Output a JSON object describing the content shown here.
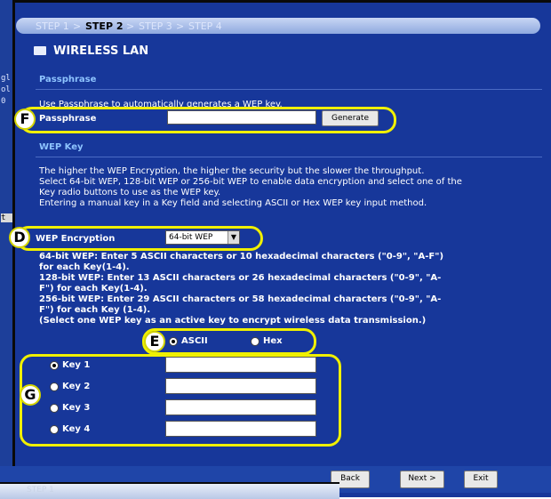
{
  "background_window": {
    "lines": [
      "gl",
      "ol",
      "0",
      "",
      "",
      "",
      "t"
    ]
  },
  "wizard": {
    "steps": [
      "STEP 1",
      "STEP 2",
      "STEP 3",
      "STEP 4"
    ],
    "title": "WIRELESS LAN"
  },
  "passphrase": {
    "section": "Passphrase",
    "description": "Use Passphrase to automatically generates a WEP key.",
    "label": "Passphrase",
    "value": "",
    "button": "Generate",
    "callout": "F"
  },
  "wep": {
    "section": "WEP Key",
    "description": [
      "The higher the WEP Encryption, the higher the security but the slower the throughput.",
      "Select 64-bit WEP, 128-bit WEP or 256-bit WEP to enable data encryption and select one of the",
      "Key radio buttons to use as the WEP key.",
      "Entering a manual key in a Key field and selecting ASCII or Hex WEP key input method."
    ],
    "encryption_label": "WEP Encryption",
    "encryption_value": "64-bit WEP",
    "encryption_callout": "D",
    "help": [
      "64-bit WEP: Enter 5 ASCII characters or 10 hexadecimal characters (\"0-9\", \"A-F\")",
      "for each Key(1-4).",
      "128-bit WEP: Enter 13 ASCII characters or 26 hexadecimal characters (\"0-9\", \"A-",
      "F\") for each Key(1-4).",
      "256-bit WEP: Enter 29 ASCII characters or 58 hexadecimal characters (\"0-9\", \"A-",
      "F\") for each Key (1-4).",
      "(Select one WEP key as an active key to encrypt wireless data transmission.)"
    ],
    "format_callout": "E",
    "format_options": [
      "ASCII",
      "Hex"
    ],
    "format_selected": "ASCII",
    "keys_callout": "G",
    "keys": [
      {
        "label": "Key 1",
        "value": "",
        "selected": true
      },
      {
        "label": "Key 2",
        "value": "",
        "selected": false
      },
      {
        "label": "Key 3",
        "value": "",
        "selected": false
      },
      {
        "label": "Key 4",
        "value": "",
        "selected": false
      }
    ]
  },
  "footer": {
    "back": "Back",
    "next": "Next >",
    "exit": "Exit"
  },
  "bottom_window": {
    "step": "STEP 1"
  },
  "colors": {
    "panel": "#17379a",
    "highlight": "#f0f000",
    "section_heading": "#8ec4ff"
  }
}
